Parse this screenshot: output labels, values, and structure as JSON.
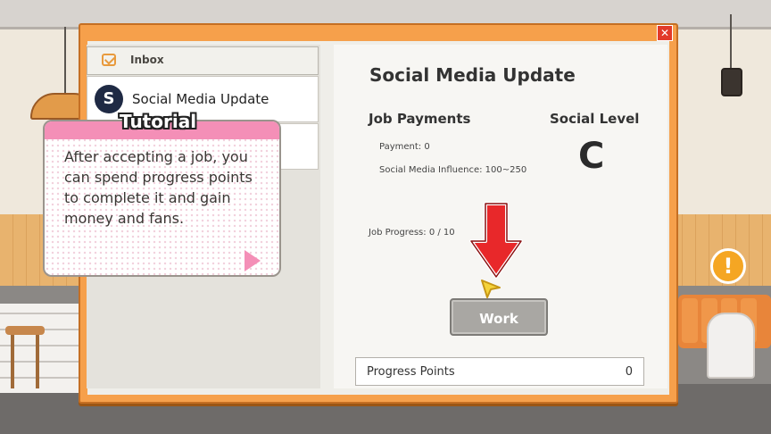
{
  "inbox": {
    "label": "Inbox",
    "items": [
      {
        "avatar_letter": "S",
        "title": "Social Media Update"
      }
    ]
  },
  "job": {
    "title": "Social Media Update",
    "payments_heading": "Job Payments",
    "payment": "Payment: 0",
    "influence": "Social Media Influence: 100~250",
    "social_level_heading": "Social Level",
    "social_level": "C",
    "progress": "Job Progress: 0 / 10",
    "work_button": "Work"
  },
  "progress_points": {
    "label": "Progress Points",
    "value": "0"
  },
  "tutorial": {
    "title": "Tutorial",
    "text": "After accepting a job, you can spend progress points to complete it and gain money and fans."
  },
  "window": {
    "close_glyph": "✕"
  },
  "alert": {
    "glyph": "!"
  },
  "colors": {
    "modal_frame": "#f6a04b",
    "tutorial_accent": "#f48fb7",
    "arrow_red": "#e8282a",
    "alert_orange": "#f5a623"
  },
  "icons": [
    "inbox-icon",
    "close-icon",
    "alert-icon",
    "down-arrow-icon",
    "cursor-icon",
    "next-arrow-icon"
  ]
}
